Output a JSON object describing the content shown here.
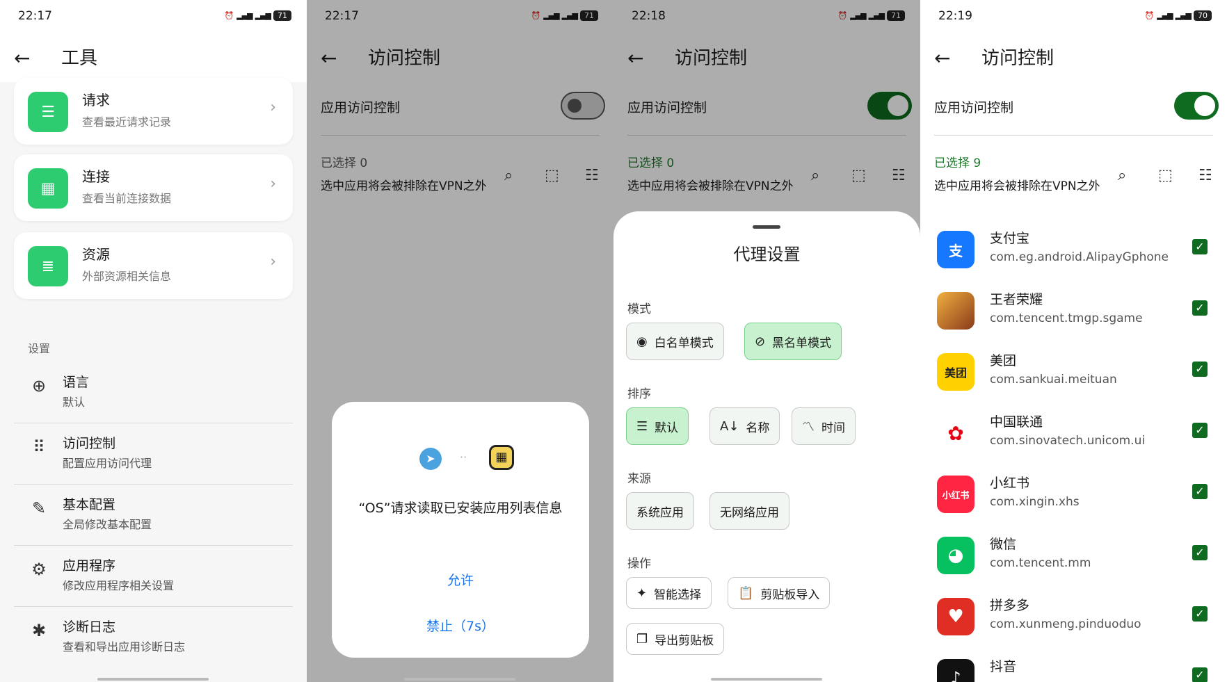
{
  "screens": [
    {
      "time": "22:17",
      "battery": "71",
      "title": "工具",
      "cards": [
        {
          "title": "请求",
          "subtitle": "查看最近请求记录"
        },
        {
          "title": "连接",
          "subtitle": "查看当前连接数据"
        },
        {
          "title": "资源",
          "subtitle": "外部资源相关信息"
        }
      ],
      "section": "设置",
      "settings": [
        {
          "title": "语言",
          "subtitle": "默认"
        },
        {
          "title": "访问控制",
          "subtitle": "配置应用访问代理"
        },
        {
          "title": "基本配置",
          "subtitle": "全局修改基本配置"
        },
        {
          "title": "应用程序",
          "subtitle": "修改应用程序相关设置"
        },
        {
          "title": "诊断日志",
          "subtitle": "查看和导出应用诊断日志"
        }
      ]
    },
    {
      "time": "22:17",
      "battery": "71",
      "title": "访问控制",
      "toggle_label": "应用访问控制",
      "toggle_on": false,
      "selected": "已选择  0",
      "hint": "选中应用将会被排除在VPN之外",
      "dialog": {
        "message": "“OS”请求读取已安装应用列表信息",
        "allow": "允许",
        "deny": "禁止（7s）"
      }
    },
    {
      "time": "22:18",
      "battery": "71",
      "title": "访问控制",
      "toggle_label": "应用访问控制",
      "toggle_on": true,
      "selected": "已选择  0",
      "hint": "选中应用将会被排除在VPN之外",
      "sheet": {
        "title": "代理设置",
        "mode_label": "模式",
        "mode_options": [
          "白名单模式",
          "黑名单模式"
        ],
        "mode_selected": "黑名单模式",
        "sort_label": "排序",
        "sort_options": [
          "默认",
          "名称",
          "时间"
        ],
        "sort_selected": "默认",
        "source_label": "来源",
        "source_options": [
          "系统应用",
          "无网络应用"
        ],
        "action_label": "操作",
        "actions": [
          "智能选择",
          "剪贴板导入",
          "导出剪贴板"
        ]
      }
    },
    {
      "time": "22:19",
      "battery": "70",
      "title": "访问控制",
      "toggle_label": "应用访问控制",
      "toggle_on": true,
      "selected": "已选择  9",
      "hint": "选中应用将会被排除在VPN之外",
      "apps": [
        {
          "name": "支付宝",
          "package": "com.eg.android.AlipayGphone",
          "color": "#1677ff",
          "glyph": "支"
        },
        {
          "name": "王者荣耀",
          "package": "com.tencent.tmgp.sgame",
          "color": "#c9812f",
          "glyph": ""
        },
        {
          "name": "美团",
          "package": "com.sankuai.meituan",
          "color": "#ffd100",
          "glyph": "美团"
        },
        {
          "name": "中国联通",
          "package": "com.sinovatech.unicom.ui",
          "color": "#ffffff",
          "glyph": "✿"
        },
        {
          "name": "小红书",
          "package": "com.xingin.xhs",
          "color": "#ff2442",
          "glyph": "小红书"
        },
        {
          "name": "微信",
          "package": "com.tencent.mm",
          "color": "#07c160",
          "glyph": "◕"
        },
        {
          "name": "拼多多",
          "package": "com.xunmeng.pinduoduo",
          "color": "#e02e24",
          "glyph": "♥"
        },
        {
          "name": "抖音",
          "package": "",
          "color": "#111111",
          "glyph": "♪"
        }
      ]
    }
  ]
}
